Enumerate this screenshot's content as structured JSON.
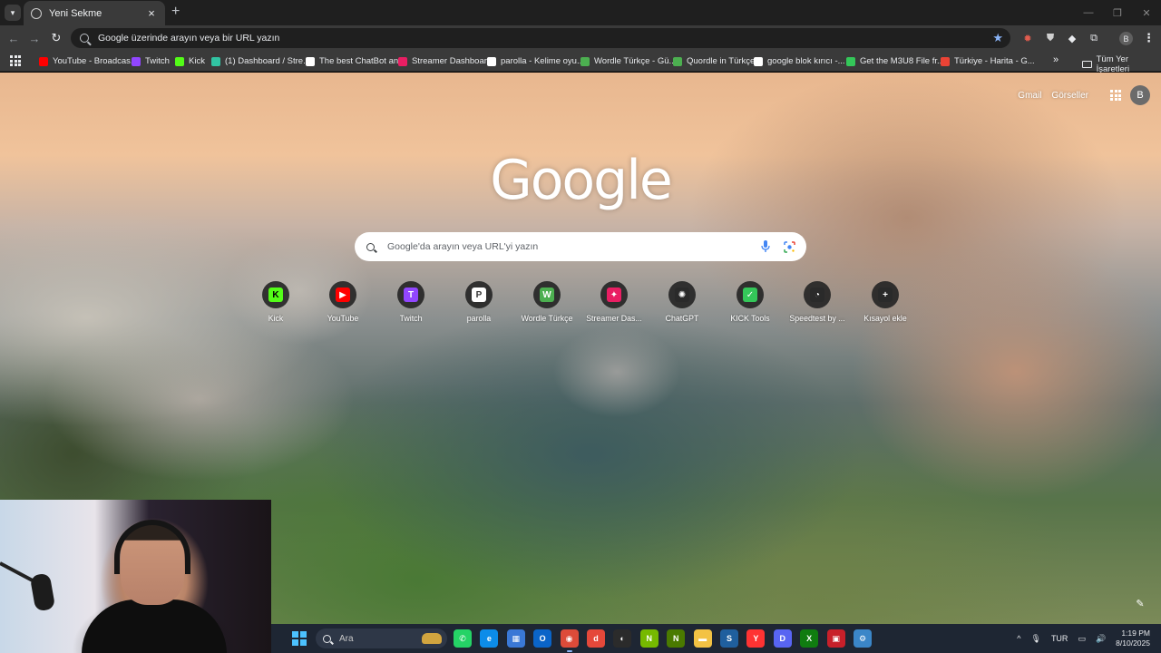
{
  "tab": {
    "title": "Yeni Sekme",
    "close": "×",
    "new_tab": "+"
  },
  "window_controls": {
    "minimize": "—",
    "maximize": "❐",
    "close": "✕"
  },
  "toolbar": {
    "back": "←",
    "forward": "→",
    "reload": "↻",
    "omnibox_placeholder": "Google üzerinde arayın veya bir URL yazın",
    "profile_initial": "B",
    "menu": "⋮"
  },
  "bookmarks": [
    {
      "label": "YouTube - Broadcas...",
      "icon": "youtube-icon",
      "color": "#ff0000"
    },
    {
      "label": "Twitch",
      "icon": "twitch-icon",
      "color": "#9146ff"
    },
    {
      "label": "Kick",
      "icon": "kick-icon",
      "color": "#53fc18"
    },
    {
      "label": "(1) Dashboard / Stre...",
      "icon": "streamlabs-icon",
      "color": "#31c3a2"
    },
    {
      "label": "The best ChatBot an...",
      "icon": "chatbot-icon",
      "color": "#ffffff"
    },
    {
      "label": "Streamer Dashboard",
      "icon": "streamer-dashboard-icon",
      "color": "#e91e63"
    },
    {
      "label": "parolla - Kelime oyu...",
      "icon": "parolla-icon",
      "color": "#ffffff"
    },
    {
      "label": "Wordle Türkçe - Gü...",
      "icon": "wordle-icon",
      "color": "#4caf50"
    },
    {
      "label": "Quordle in Türkçe",
      "icon": "quordle-icon",
      "color": "#4caf50"
    },
    {
      "label": "google blok kırıcı -...",
      "icon": "google-icon",
      "color": "#ffffff"
    },
    {
      "label": "Get the M3U8 File fr...",
      "icon": "m3u8-icon",
      "color": "#34c759"
    },
    {
      "label": "Türkiye - Harita - G...",
      "icon": "maps-pin-icon",
      "color": "#ea4335"
    }
  ],
  "bookmarks_more": "»",
  "bookmarks_folder": "Tüm Yer İşaretleri",
  "ntp": {
    "gmail": "Gmail",
    "images": "Görseller",
    "avatar": "B",
    "logo": "Google",
    "search_placeholder": "Google'da arayın veya URL'yi yazın",
    "shortcuts": [
      {
        "label": "Kick",
        "glyph": "K",
        "color": "#53fc18",
        "text_color": "#000000"
      },
      {
        "label": "YouTube",
        "glyph": "▶",
        "color": "#ff0000",
        "text_color": "#ffffff"
      },
      {
        "label": "Twitch",
        "glyph": "T",
        "color": "#9146ff",
        "text_color": "#ffffff"
      },
      {
        "label": "parolla",
        "glyph": "P",
        "color": "#ffffff",
        "text_color": "#333333"
      },
      {
        "label": "Wordle Türkçe",
        "glyph": "W",
        "color": "#4caf50",
        "text_color": "#ffffff"
      },
      {
        "label": "Streamer Das...",
        "glyph": "✦",
        "color": "#e91e63",
        "text_color": "#ffffff"
      },
      {
        "label": "ChatGPT",
        "glyph": "✺",
        "color": "#2a2a2a",
        "text_color": "#ffffff"
      },
      {
        "label": "KICK Tools",
        "glyph": "✓",
        "color": "#34c759",
        "text_color": "#ffffff"
      },
      {
        "label": "Speedtest by ...",
        "glyph": "◔",
        "color": "#2a2a2a",
        "text_color": "#ffffff"
      },
      {
        "label": "Kısayol ekle",
        "glyph": "+",
        "color": "#2a2a2a",
        "text_color": "#ffffff"
      }
    ],
    "customize": "✎"
  },
  "taskbar": {
    "search_label": "Ara",
    "apps": [
      {
        "name": "whatsapp-icon",
        "glyph": "✆",
        "color": "#25d366"
      },
      {
        "name": "edge-icon",
        "glyph": "e",
        "color": "#0c8ce9"
      },
      {
        "name": "store-icon",
        "glyph": "▦",
        "color": "#3a78d6"
      },
      {
        "name": "outlook-icon",
        "glyph": "O",
        "color": "#0a64c8"
      },
      {
        "name": "chrome-icon",
        "glyph": "◉",
        "color": "#dd4b39"
      },
      {
        "name": "obs-alt-icon",
        "glyph": "d",
        "color": "#e5483a"
      },
      {
        "name": "obs-icon",
        "glyph": "◐",
        "color": "#2b2b2b"
      },
      {
        "name": "nvidia-icon",
        "glyph": "N",
        "color": "#76b900"
      },
      {
        "name": "nvidia-broadcast-icon",
        "glyph": "N",
        "color": "#4a7a00"
      },
      {
        "name": "file-explorer-icon",
        "glyph": "▬",
        "color": "#f3c244"
      },
      {
        "name": "steam-icon",
        "glyph": "S",
        "color": "#1f5f9e"
      },
      {
        "name": "yandex-icon",
        "glyph": "Y",
        "color": "#ff3333"
      },
      {
        "name": "discord-icon",
        "glyph": "D",
        "color": "#5865f2"
      },
      {
        "name": "xbox-icon",
        "glyph": "X",
        "color": "#107c10"
      },
      {
        "name": "game-icon",
        "glyph": "▣",
        "color": "#c8202a"
      },
      {
        "name": "settings-app-icon",
        "glyph": "⚙",
        "color": "#3b86c8"
      }
    ],
    "tray": {
      "chevron": "^",
      "mic": "🎙",
      "lang": "TUR",
      "network": "▭",
      "volume": "🔊"
    },
    "time": "1:19 PM",
    "date": "8/10/2025"
  }
}
